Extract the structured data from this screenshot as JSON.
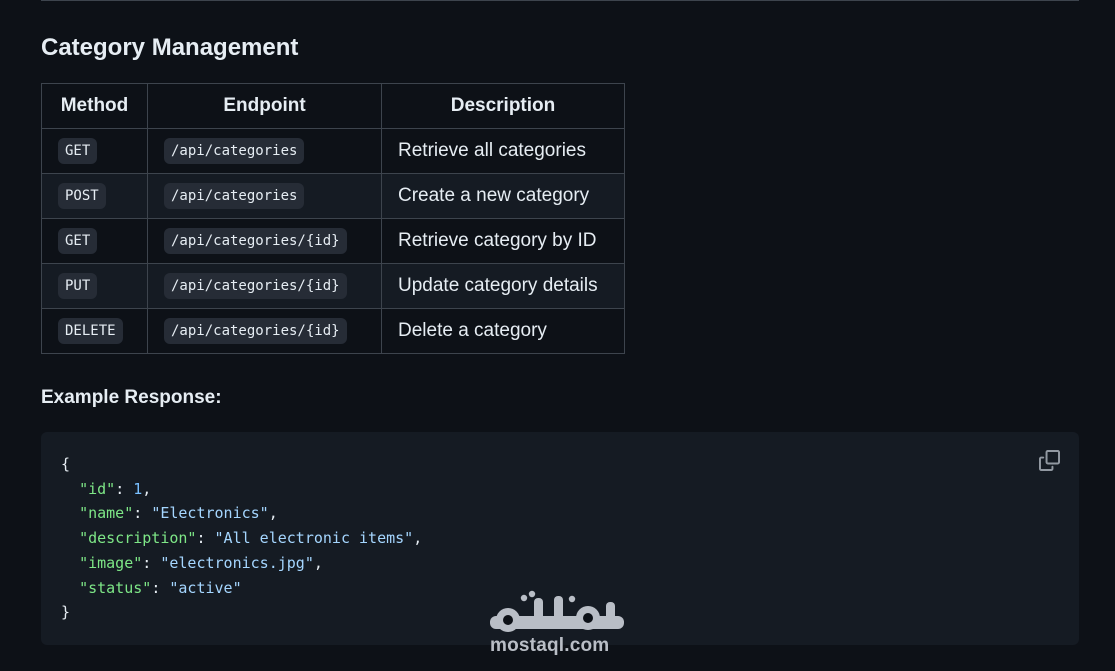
{
  "section": {
    "title": "Category Management"
  },
  "table": {
    "headers": [
      "Method",
      "Endpoint",
      "Description"
    ],
    "rows": [
      {
        "method": "GET",
        "endpoint": "/api/categories",
        "description": "Retrieve all categories"
      },
      {
        "method": "POST",
        "endpoint": "/api/categories",
        "description": "Create a new category"
      },
      {
        "method": "GET",
        "endpoint": "/api/categories/{id}",
        "description": "Retrieve category by ID"
      },
      {
        "method": "PUT",
        "endpoint": "/api/categories/{id}",
        "description": "Update category details"
      },
      {
        "method": "DELETE",
        "endpoint": "/api/categories/{id}",
        "description": "Delete a category"
      }
    ]
  },
  "example": {
    "label": "Example Response:",
    "open_brace": "{",
    "close_brace": "}",
    "fields": [
      {
        "key": "\"id\"",
        "value": "1",
        "type": "number",
        "comma": ","
      },
      {
        "key": "\"name\"",
        "value": "\"Electronics\"",
        "type": "string",
        "comma": ","
      },
      {
        "key": "\"description\"",
        "value": "\"All electronic items\"",
        "type": "string",
        "comma": ","
      },
      {
        "key": "\"image\"",
        "value": "\"electronics.jpg\"",
        "type": "string",
        "comma": ","
      },
      {
        "key": "\"status\"",
        "value": "\"active\"",
        "type": "string",
        "comma": ""
      }
    ],
    "copy_icon": "copy-icon"
  },
  "watermark": {
    "arabic": "مستقل",
    "latin": "mostaql.com"
  },
  "colors": {
    "background": "#0d1117",
    "code_background": "#151b23",
    "border": "#3d444d",
    "json_key": "#7ee787",
    "json_string": "#a5d6ff",
    "json_number": "#79c0ff"
  }
}
